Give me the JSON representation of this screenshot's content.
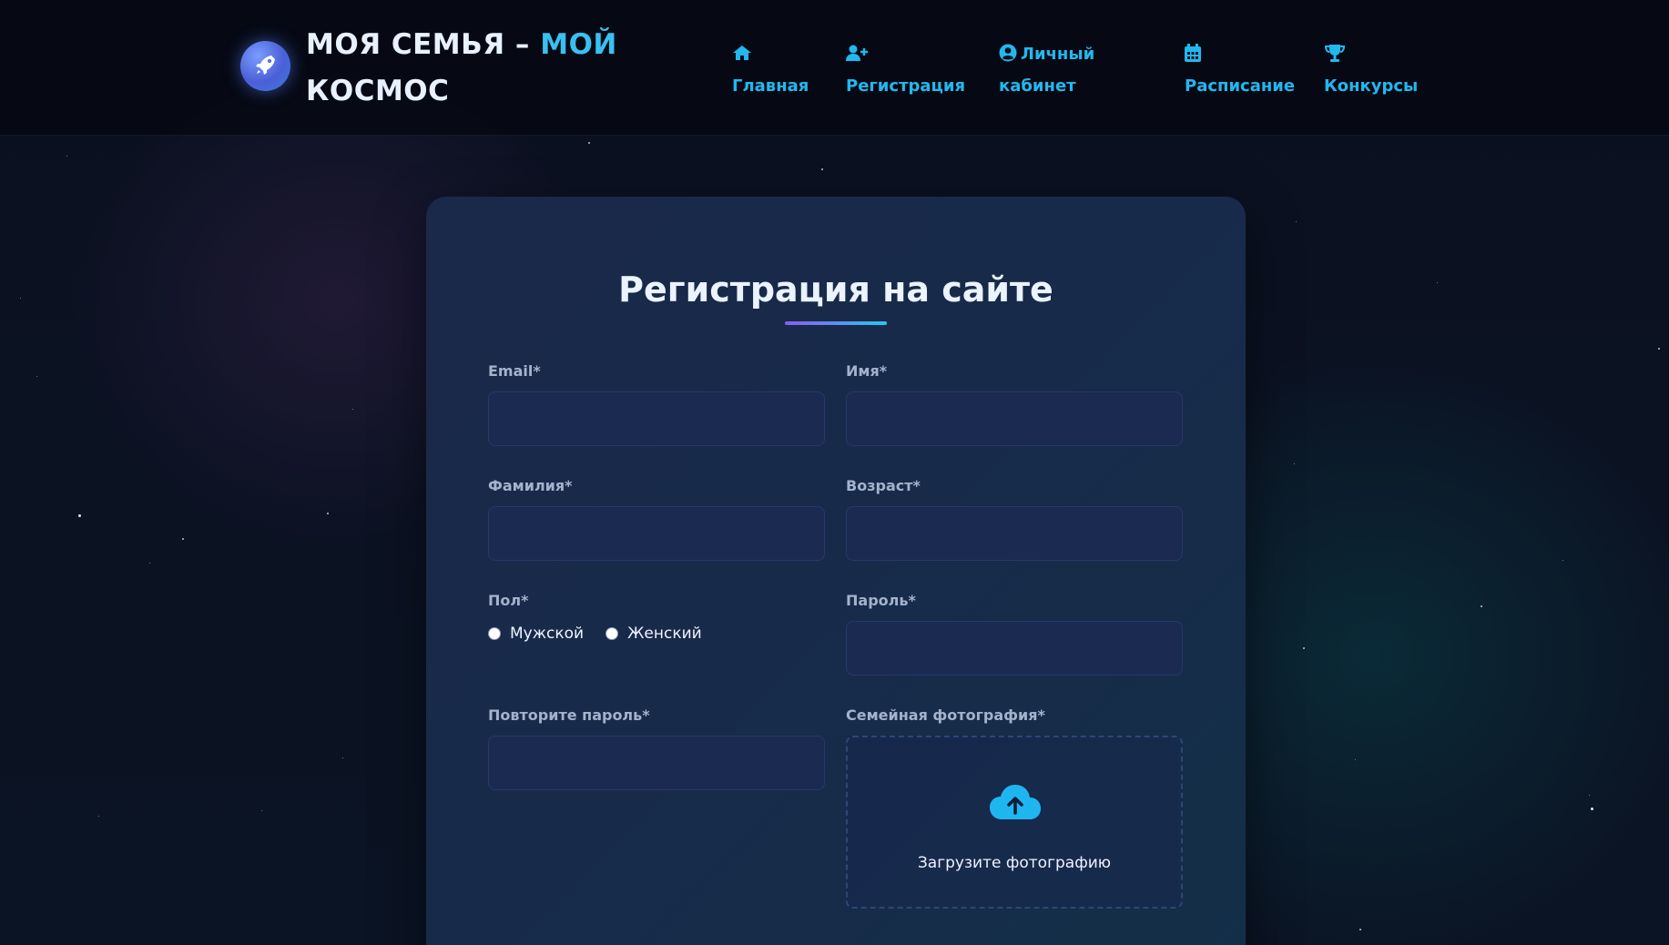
{
  "brand": {
    "title_part1": "МОЯ СЕМЬЯ – ",
    "title_accent": "МОЙ",
    "title_line2": "КОСМОС",
    "logo_icon": "rocket-icon",
    "accent_color": "#39c0f0"
  },
  "nav": {
    "items": [
      {
        "label": "Главная",
        "icon": "home-icon"
      },
      {
        "label": "Регистрация",
        "icon": "user-plus-icon"
      },
      {
        "label_line1": "Личный",
        "label_line2": "кабинет",
        "icon": "user-circle-icon"
      },
      {
        "label": "Расписание",
        "icon": "calendar-icon"
      },
      {
        "label": "Конкурсы",
        "icon": "trophy-icon"
      }
    ],
    "color": "#22b8ef"
  },
  "form": {
    "title": "Регистрация на сайте",
    "fields": {
      "email": {
        "label": "Email*",
        "value": "",
        "placeholder": ""
      },
      "first_name": {
        "label": "Имя*",
        "value": "",
        "placeholder": ""
      },
      "last_name": {
        "label": "Фамилия*",
        "value": "",
        "placeholder": ""
      },
      "age": {
        "label": "Возраст*",
        "value": "",
        "placeholder": ""
      },
      "gender": {
        "label": "Пол*",
        "options": [
          "Мужской",
          "Женский"
        ],
        "selected": ""
      },
      "password": {
        "label": "Пароль*",
        "value": "",
        "placeholder": ""
      },
      "password_repeat": {
        "label": "Повторите пароль*",
        "value": "",
        "placeholder": ""
      },
      "family_photo": {
        "label": "Семейная фотография*",
        "upload_text": "Загрузите фотографию",
        "icon": "cloud-upload-icon"
      }
    }
  }
}
